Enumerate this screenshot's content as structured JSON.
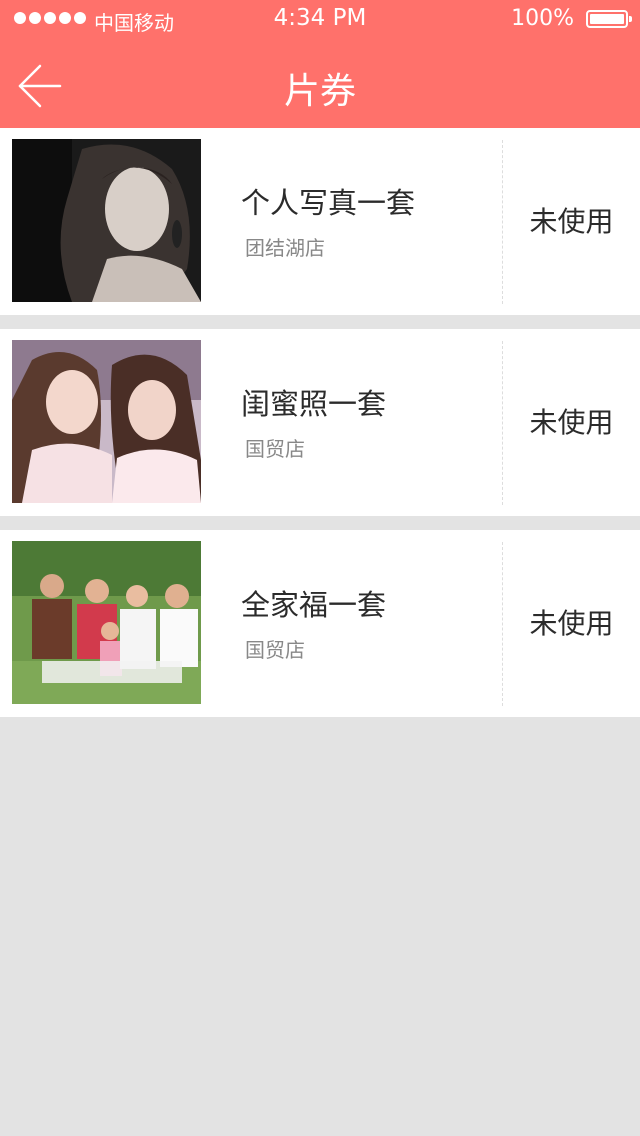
{
  "status_bar": {
    "carrier": "中国移动",
    "time": "4:34 PM",
    "battery": "100%"
  },
  "nav": {
    "title": "片券",
    "back_icon": "back-arrow-icon"
  },
  "colors": {
    "header": "#ff716b",
    "background": "#e3e3e3",
    "card": "#ffffff"
  },
  "tickets": [
    {
      "name": "个人写真一套",
      "store": "团结湖店",
      "status": "未使用"
    },
    {
      "name": "闺蜜照一套",
      "store": "国贸店",
      "status": "未使用"
    },
    {
      "name": "全家福一套",
      "store": "国贸店",
      "status": "未使用"
    }
  ]
}
